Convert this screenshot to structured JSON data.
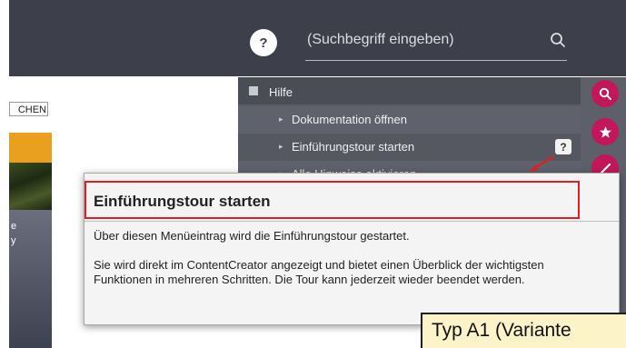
{
  "header": {
    "help_icon_label": "?",
    "search_placeholder": "(Suchbegriff eingeben)"
  },
  "left": {
    "button_fragment": "CHEN",
    "photo_fragments": [
      "e",
      "y"
    ]
  },
  "menu": {
    "header_label": "Hilfe",
    "items": [
      {
        "label": "Dokumentation öffnen"
      },
      {
        "label": "Einführungstour starten",
        "help": "?"
      },
      {
        "label": "Alle Hinweise aktivieren"
      }
    ]
  },
  "tooltip": {
    "title": "Einführungstour starten",
    "paragraph1": "Über diesen Menüeintrag wird die Einführungstour gestartet.",
    "paragraph2": "Sie wird direkt im ContentCreator angezeigt und bietet einen Überblick der wichtigsten Funktionen in mehreren Schritten. Die Tour kann jederzeit wieder beendet werden."
  },
  "annotation": {
    "label": "Typ A1 (Variante"
  },
  "icons": [
    "help-icon",
    "search-icon",
    "book-icon",
    "chevron-right-icon",
    "search-icon",
    "star-icon",
    "edit-icon"
  ],
  "colors": {
    "topbar": "#3d3f4a",
    "accent": "#c2185b",
    "highlight": "#e02020",
    "annotation_bg": "#fdf3c8",
    "orange": "#e8a01e"
  }
}
